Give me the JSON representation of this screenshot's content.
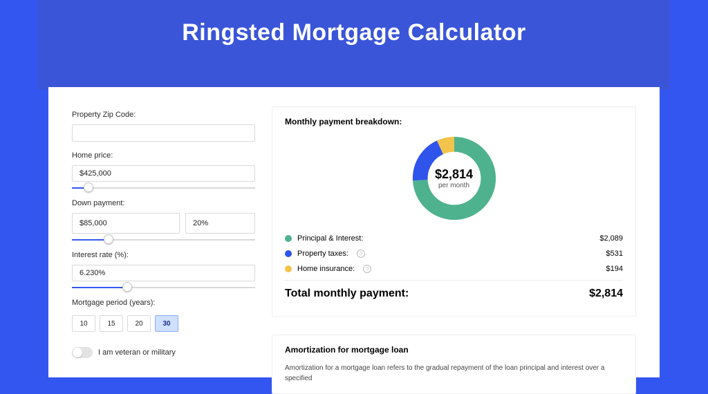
{
  "hero": {
    "title": "Ringsted Mortgage Calculator"
  },
  "form": {
    "zip_label": "Property Zip Code:",
    "zip_value": "",
    "home_label": "Home price:",
    "home_value": "$425,000",
    "home_slider_pct": 9,
    "down_label": "Down payment:",
    "down_value": "$85,000",
    "down_pct": "20%",
    "down_slider_pct": 20,
    "rate_label": "Interest rate (%):",
    "rate_value": "6.230%",
    "rate_slider_pct": 30,
    "period_label": "Mortgage period (years):",
    "periods": [
      "10",
      "15",
      "20",
      "30"
    ],
    "active_period": "30",
    "veteran_label": "I am veteran or military"
  },
  "breakdown": {
    "title": "Monthly payment breakdown:",
    "center_value": "$2,814",
    "center_sub": "per month",
    "items": [
      {
        "label": "Principal & Interest:",
        "value": "$2,089",
        "color": "#4fb28e",
        "pct": 74,
        "help": false
      },
      {
        "label": "Property taxes:",
        "value": "$531",
        "color": "#2f54eb",
        "pct": 19,
        "help": true
      },
      {
        "label": "Home insurance:",
        "value": "$194",
        "color": "#f3c44b",
        "pct": 7,
        "help": true
      }
    ],
    "total_label": "Total monthly payment:",
    "total_value": "$2,814"
  },
  "amort": {
    "title": "Amortization for mortgage loan",
    "body": "Amortization for a mortgage loan refers to the gradual repayment of the loan principal and interest over a specified"
  },
  "chart_data": {
    "type": "pie",
    "title": "Monthly payment breakdown",
    "series": [
      {
        "name": "Principal & Interest",
        "value": 2089,
        "color": "#4fb28e"
      },
      {
        "name": "Property taxes",
        "value": 531,
        "color": "#2f54eb"
      },
      {
        "name": "Home insurance",
        "value": 194,
        "color": "#f3c44b"
      }
    ],
    "total": 2814,
    "center_label": "$2,814 per month"
  }
}
